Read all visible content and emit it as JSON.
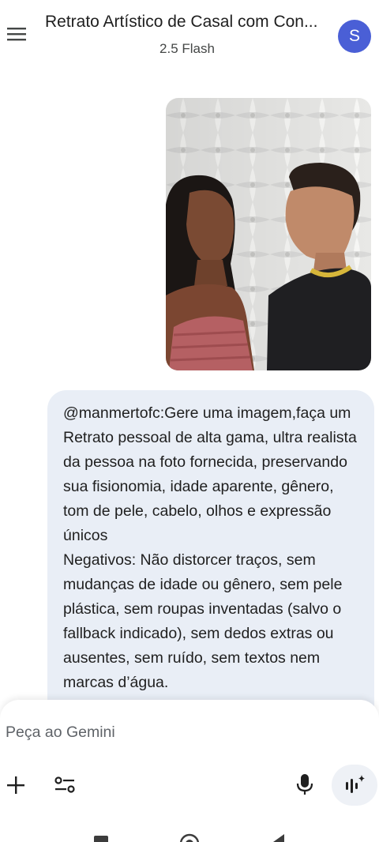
{
  "header": {
    "title": "Retrato Artístico de Casal com Con...",
    "model": "2.5 Flash",
    "avatar_initial": "S"
  },
  "conversation": {
    "uploaded_image_label": "Foto enviada: casal de perfil diante de parede branca com relevo",
    "user_message": "@manmertofc:Gere uma imagem,faça um Retrato pessoal de alta gama, ultra realista da pessoa na foto fornecida, preservando sua fisionomia, idade aparente, gênero, tom de pele, cabelo, olhos e expressão únicos\nNegativos: Não distorcer traços, sem mudanças de idade ou gênero, sem pele plástica, sem roupas inventadas (salvo o fallback indicado), sem dedos extras ou ausentes, sem ruído, sem textos nem marcas d’água."
  },
  "composer": {
    "placeholder": "Peça ao Gemini",
    "value": ""
  },
  "icons": {
    "menu": "menu-icon",
    "plus": "plus-icon",
    "tools": "tools-sliders-icon",
    "mic": "mic-icon",
    "live": "gemini-live-icon"
  },
  "colors": {
    "avatar_bg": "#4a5fd6",
    "bubble_bg": "#e9eef6",
    "text": "#1f1f1f",
    "secondary_text": "#444746"
  }
}
